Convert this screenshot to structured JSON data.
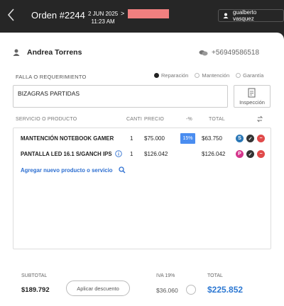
{
  "header": {
    "order_title": "Orden #2244",
    "date_line1": "2 JUN 2025",
    "date_line2": "11:23 AM",
    "date_chevron": ">",
    "user_name": "gualberto vasquez",
    "status_color": "#f07f7f"
  },
  "customer": {
    "name": "Andrea Torrens",
    "phone": "+56949586518",
    "icons": [
      "user-icon",
      "chat-bubbles-icon"
    ]
  },
  "requirement": {
    "label": "FALLA O REQUERIMIENTO",
    "value": "BIZAGRAS PARTIDAS",
    "options": [
      {
        "label": "Reparación",
        "selected": true
      },
      {
        "label": "Mantención",
        "selected": false
      },
      {
        "label": "Garantía",
        "selected": false
      }
    ],
    "inspection_button": "Inspección"
  },
  "table": {
    "headers": {
      "product": "SERVICIO O PRODUCTO",
      "qty": "CANTI",
      "price": "PRECIO",
      "discount": "-%",
      "total": "TOTAL"
    },
    "rows": [
      {
        "product": "MANTENCIÓN NOTEBOOK GAMER",
        "qty": "1",
        "price": "$75.000",
        "discount": "15%",
        "total": "$63.750",
        "type_badge": "S",
        "type_color": "#2a77b6"
      },
      {
        "product": "PANTALLA LED 16.1 S/GANCH IPS",
        "qty": "1",
        "price": "$126.042",
        "discount": "",
        "total": "$126.042",
        "type_badge": "P",
        "type_color": "#d4348b"
      }
    ],
    "add_link": "Agregar nuevo producto o servicio"
  },
  "footer": {
    "subtotal_label": "SUBTOTAL",
    "subtotal": "$189.792",
    "discount_button": "Aplicar descuento",
    "iva_label": "IVA 19%",
    "iva_value": "$36.060",
    "total_label": "TOTAL",
    "total": "$225.852"
  },
  "colors": {
    "accent": "#2d78d2",
    "discount_badge": "#4a8df0",
    "delete": "#e04a4a",
    "topbar": "#262626"
  }
}
